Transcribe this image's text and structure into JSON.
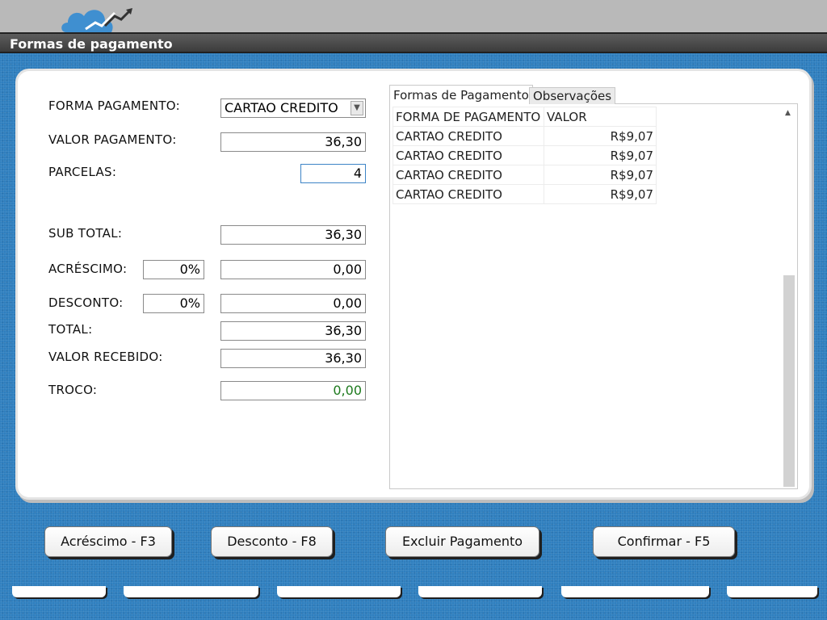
{
  "window": {
    "title": "Formas de pagamento"
  },
  "form": {
    "forma_pagamento": {
      "label": "FORMA PAGAMENTO:",
      "value": "CARTAO CREDITO"
    },
    "valor_pagamento": {
      "label": "VALOR PAGAMENTO:",
      "value": "36,30"
    },
    "parcelas": {
      "label": "PARCELAS:",
      "value": "4"
    },
    "sub_total": {
      "label": "SUB TOTAL:",
      "value": "36,30"
    },
    "acrescimo": {
      "label": "ACRÉSCIMO:",
      "percent": "0%",
      "value": "0,00"
    },
    "desconto": {
      "label": "DESCONTO:",
      "percent": "0%",
      "value": "0,00"
    },
    "total": {
      "label": "TOTAL:",
      "value": "36,30"
    },
    "valor_recebido": {
      "label": "VALOR RECEBIDO:",
      "value": "36,30"
    },
    "troco": {
      "label": "TROCO:",
      "value": "0,00",
      "color": "#1e7a1e"
    }
  },
  "tabs": [
    {
      "label": "Formas de Pagamento",
      "active": true
    },
    {
      "label": "Observações",
      "active": false
    }
  ],
  "grid": {
    "columns": [
      "FORMA DE PAGAMENTO",
      "VALOR"
    ],
    "rows": [
      [
        "CARTAO CREDITO",
        "R$9,07"
      ],
      [
        "CARTAO CREDITO",
        "R$9,07"
      ],
      [
        "CARTAO CREDITO",
        "R$9,07"
      ],
      [
        "CARTAO CREDITO",
        "R$9,07"
      ]
    ]
  },
  "buttons": {
    "acrescimo": "Acréscimo - F3",
    "desconto": "Desconto - F8",
    "excluir": "Excluir Pagamento",
    "confirmar": "Confirmar - F5"
  },
  "icons": {
    "logo": "cloud-chart-logo-icon",
    "scroll_up": "chevron-up-icon",
    "combo": "chevron-down-icon"
  },
  "colors": {
    "background": "#2f7fbf",
    "titlebar": "#4a4a4a",
    "troco": "#1e7a1e"
  }
}
